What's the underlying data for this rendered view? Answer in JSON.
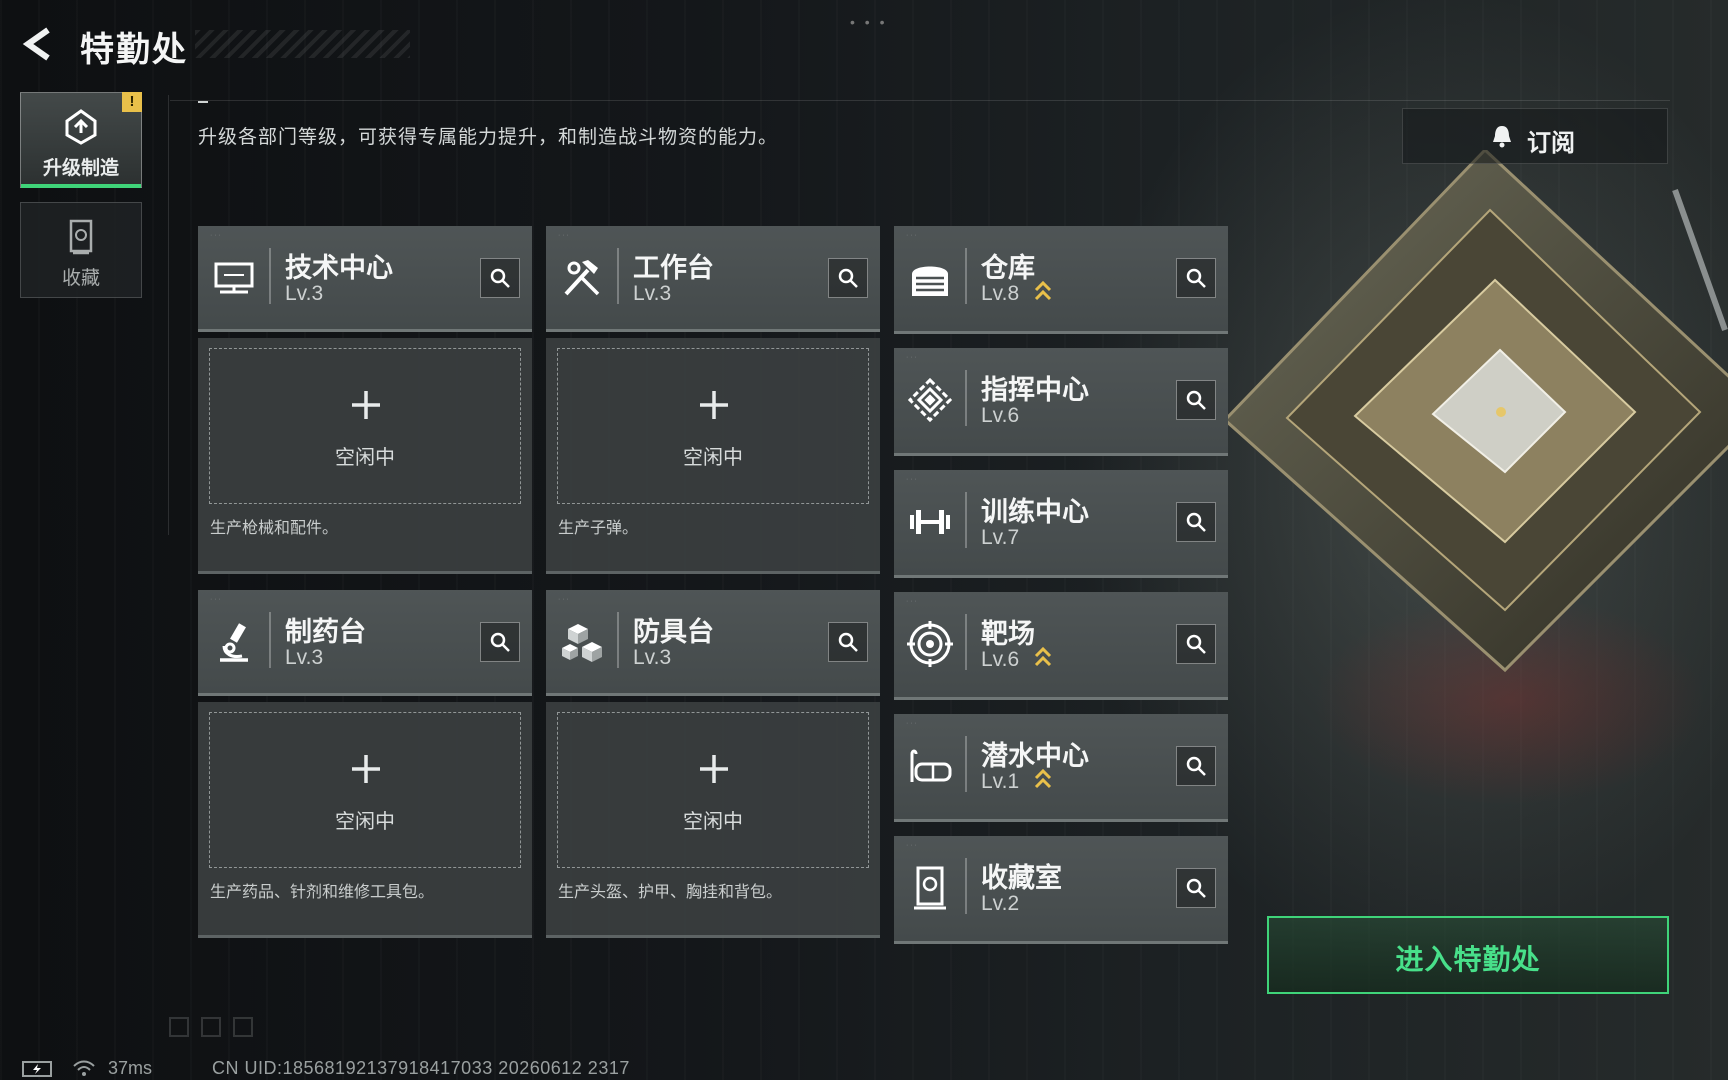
{
  "header": {
    "title": "特勤处",
    "back_icon": "chevron-left-icon"
  },
  "nav": {
    "items": [
      {
        "label": "升级制造",
        "icon": "upgrade-gear-icon",
        "active": true,
        "badge": "!"
      },
      {
        "label": "收藏",
        "icon": "collection-cabinet-icon",
        "active": false
      }
    ]
  },
  "description": "升级各部门等级，可获得专属能力提升，和制造战斗物资的能力。",
  "subscribe": {
    "label": "订阅",
    "icon": "bell-icon"
  },
  "production_facilities": [
    {
      "name": "技术中心",
      "level": "Lv.3",
      "icon": "monitor-icon",
      "slot_status": "空闲中",
      "production": "生产枪械和配件。"
    },
    {
      "name": "工作台",
      "level": "Lv.3",
      "icon": "hammer-wrench-icon",
      "slot_status": "空闲中",
      "production": "生产子弹。"
    },
    {
      "name": "制药台",
      "level": "Lv.3",
      "icon": "microscope-icon",
      "slot_status": "空闲中",
      "production": "生产药品、针剂和维修工具包。"
    },
    {
      "name": "防具台",
      "level": "Lv.3",
      "icon": "armor-blocks-icon",
      "slot_status": "空闲中",
      "production": "生产头盔、护甲、胸挂和背包。"
    }
  ],
  "side_facilities": [
    {
      "name": "仓库",
      "level": "Lv.8",
      "icon": "warehouse-icon",
      "upgradable": true
    },
    {
      "name": "指挥中心",
      "level": "Lv.6",
      "icon": "command-diamond-icon",
      "upgradable": false
    },
    {
      "name": "训练中心",
      "level": "Lv.7",
      "icon": "dumbbell-icon",
      "upgradable": false
    },
    {
      "name": "靶场",
      "level": "Lv.6",
      "icon": "target-icon",
      "upgradable": true
    },
    {
      "name": "潜水中心",
      "level": "Lv.1",
      "icon": "diving-mask-icon",
      "upgradable": true
    },
    {
      "name": "收藏室",
      "level": "Lv.2",
      "icon": "collection-cabinet-icon",
      "upgradable": false
    }
  ],
  "enter_button": {
    "label": "进入特勤处"
  },
  "status_bar": {
    "ping": "37ms",
    "uid": "CN UID:18568192137918417033 20260612 2317"
  },
  "colors": {
    "accent": "#3fd479",
    "upgrade_arrow": "#e9c04a",
    "badge": "#e9c04a"
  }
}
